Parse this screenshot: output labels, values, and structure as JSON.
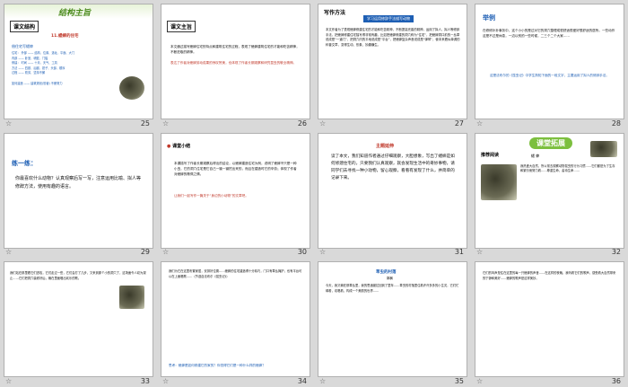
{
  "slides": [
    {
      "number": "25",
      "title": "结构主旨",
      "chart_tab": "课文结构",
      "heading": "11.蟋蟀的住宅",
      "sub": "借住宅写蟋蟀",
      "lines": [
        "住宅：  外部 —— 结构、位置、选址、平面、大门",
        "       内部 —— 卧室、墙壁、门槛",
        "修建：  时间 —— 十月、天气、工具",
        "       方法 —— 四肢、后腿、钳子、头部、顺序",
        "       过程 —— 勤劳、坚持不懈"
      ],
      "footer": "如何建造 —— 建筑规划(勤奋)    不断努力"
    },
    {
      "number": "26",
      "tab": "课文主旨",
      "text": "本文通过描写蟋蟀住宅的特点和建筑住宅的过程，表现了蟋蟀建筑住宅的才能和吃苦精神，不断进取的精神。",
      "red_text": "表达了作者对蟋蟀劳动成果的惊叹赞美，也体现了作者长期观察和研究昆虫的敬业精神。"
    },
    {
      "number": "27",
      "heading": "写作方法",
      "blue_box": "学习运用修辞手法描写动物",
      "text": "本文作者为了表现蟋蟀修建住宅的才能和吃苦精神，不断提高完善的精神，运用了拟人、拟人等修辞手法，把蟋蟀修建住宅描写得非常有趣，比如把蟋蟀修建的洞穴称为“住宅”，把蟋蟀洞口前的一丛草说成是“一道门”，把洞穴内的平地说成是“平台”，把蟋蟀复杂声音说成是“弹琴”，使本来看似单调的科普文章，变得生动、形象、妙趣横生。"
    },
    {
      "number": "28",
      "tab": "举例",
      "text": "在修修补补事务中，这个小小的是过对它的洞穴整理成很舒适很爱好很舒适的居所。一些动作这是不过是休息，一边以别的一些时候，二三个二个大家……",
      "blue_text": "这是法布尔的《昆虫记》中学生熟知下面的一段文字，主要运用了拟人的修辞手法。"
    },
    {
      "number": "29",
      "tab": "练一练：",
      "text": "你最喜欢什么动物？认真观察后写一写，注意运用比喻、拟人等修辞方法，使用有趣的语言。"
    },
    {
      "number": "30",
      "tab": "课堂小结",
      "text": "本课描写了作者长期观察后得出的结论，以蟋蟀建造住宅为例，说明了蟋蟀不只是一种小虫，它的洞穴住宅是它自己一锄一锄挖出来的，而且在建造时它的辛劳；体现了作者对蟋蟀的敬佩之情。",
      "red_text": "让我们一起写作一篇关于“身边的小动物”的文章吧。"
    },
    {
      "number": "31",
      "heading": "主题延伸",
      "text": "读了本文，我们知道作者通过仔细观察，大胆想象，写出了蟋蟀是如何修建住宅的，只要我们认真观察，就会发现生活中的奇妙事物，请同学们去寻找一种小动物，留心观察，看看有发现了什么，并简单的记录下来。"
    },
    {
      "number": "32",
      "tag": "课堂拓展",
      "sub_tab": "推荐阅读",
      "title": "蟋 蟀",
      "text": "我热爱大自然，所以常去观察动物昆虫的行为习惯……它们都是为了生存和繁衍而努力着……尊重生命，善待生命……"
    },
    {
      "number": "33",
      "text": "我们站在那里看它们进攻，它们走过一些，它们会打了几步，又来到那个小的洞穴了，这场面令人叹为观止……它们把洞穴装修好后，躲在里面唱出欢乐的歌。"
    },
    {
      "number": "34",
      "text": "我们为它在这里布置家居，安排好位置……蟋蟀的住宅建造得十分精巧，门口有草丛掩护，也有平台可以在上面唱歌……（节选自法布尔《昆虫记》）",
      "question": "思考：蟋蟀是如何修建它的家的？你觉得它们是一种什么样的蟋蟀？"
    },
    {
      "number": "35",
      "title": "草虫的村落",
      "author": "郭枫",
      "text": "今天，我又躺在那草丛里，我的思绪被拉回到了童年……草虫的村落里住着许许多多的小生灵，它们忙碌着，欢唱着，构成一个美丽的世界……"
    },
    {
      "number": "36",
      "text": "它们的叫声是住在这里的每一只蟋蟀的声音……在这样的夜晚，我听着它们的歌声，感受着大自然带来的宁静和美好……蟋蟀的歌声是这样美妙。"
    }
  ],
  "star_glyph": "☆"
}
